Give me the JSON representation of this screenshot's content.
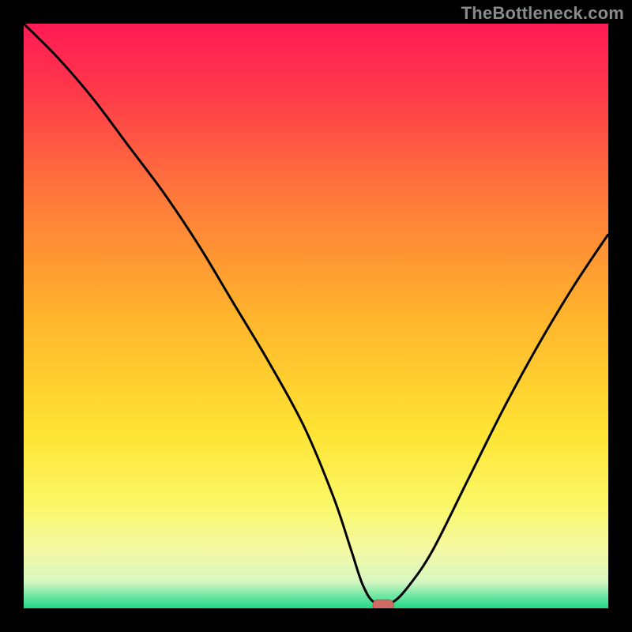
{
  "watermark": "TheBottleneck.com",
  "colors": {
    "frame": "#000000",
    "gradient_stops": [
      {
        "offset": 0.0,
        "color": "#ff1a55"
      },
      {
        "offset": 0.12,
        "color": "#ff3a4a"
      },
      {
        "offset": 0.3,
        "color": "#ff7a3a"
      },
      {
        "offset": 0.5,
        "color": "#ffb42c"
      },
      {
        "offset": 0.7,
        "color": "#ffe433"
      },
      {
        "offset": 0.82,
        "color": "#fbf766"
      },
      {
        "offset": 0.9,
        "color": "#f4f9a4"
      },
      {
        "offset": 0.955,
        "color": "#d6f7c2"
      },
      {
        "offset": 0.975,
        "color": "#7ee9a8"
      },
      {
        "offset": 1.0,
        "color": "#1fd98a"
      }
    ],
    "curve": "#000000",
    "marker_fill": "#cf6b64",
    "marker_stroke": "#b9574e"
  },
  "chart_data": {
    "type": "line",
    "title": "",
    "xlabel": "",
    "ylabel": "",
    "xlim": [
      0,
      100
    ],
    "ylim": [
      0,
      100
    ],
    "series": [
      {
        "name": "bottleneck-curve",
        "x": [
          0,
          6,
          12,
          18,
          24,
          30,
          36,
          42,
          48,
          53,
          56,
          58,
          60,
          63,
          66,
          70,
          76,
          82,
          88,
          94,
          100
        ],
        "y": [
          100,
          94,
          87,
          79,
          71,
          62,
          52,
          42,
          31,
          19,
          10,
          4,
          1,
          1,
          4,
          10,
          22,
          34,
          45,
          55,
          64
        ]
      }
    ],
    "marker": {
      "x": 61.5,
      "y": 0.5
    }
  }
}
